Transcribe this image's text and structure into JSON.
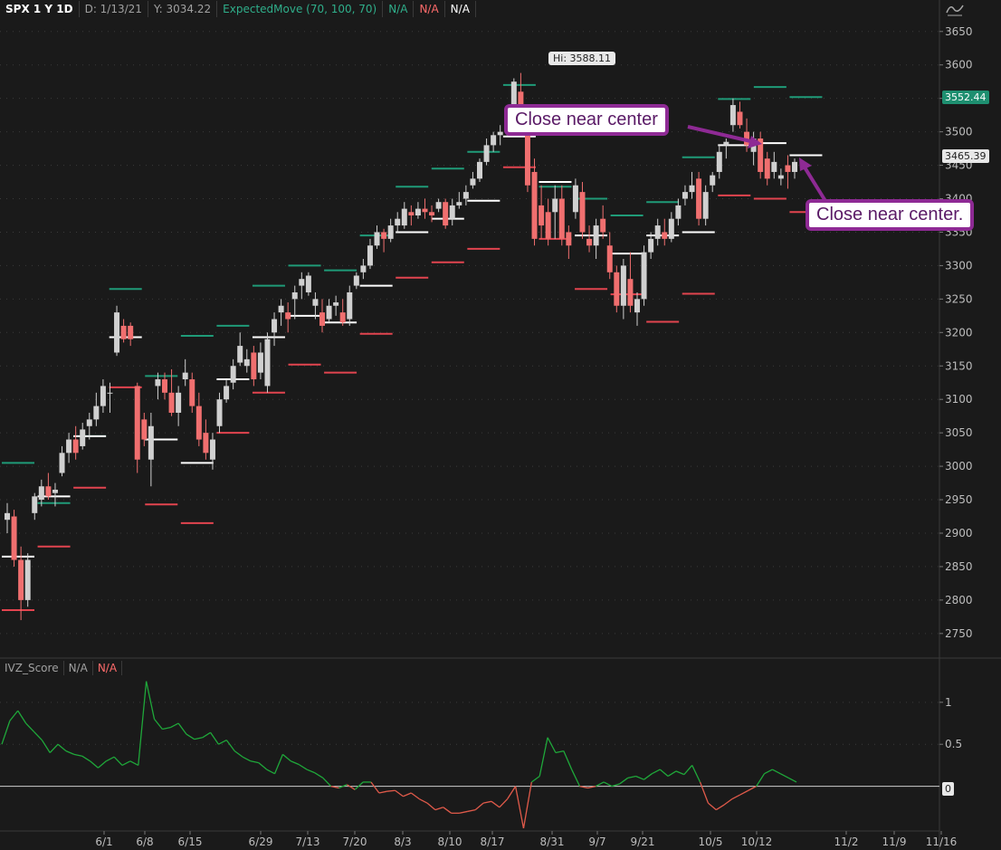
{
  "header": {
    "symbol": "SPX 1 Y 1D",
    "date": "D: 1/13/21",
    "y_readout": "Y: 3034.22",
    "study": "ExpectedMove (70, 100, 70)",
    "v1": "N/A",
    "v2": "N/A",
    "v3": "N/A"
  },
  "lower_header": {
    "study": "IVZ_Score",
    "v1": "N/A",
    "v2": "N/A"
  },
  "colors": {
    "background": "#1a1a1a",
    "up_candle": "#d0d0d0",
    "down_candle": "#f06f6f",
    "upper_band": "#1f9b78",
    "lower_band": "#e2444f",
    "center": "#ffffff",
    "osc_up": "#1fa83a",
    "osc_down": "#e05a4a",
    "callout_border": "#8e2a94"
  },
  "annotations": {
    "hi_label": "Hi: 3588.11",
    "callout1": "Close near center",
    "callout2": "Close near center.",
    "price_badge_green": "3552.44",
    "price_badge_white": "3465.39",
    "osc_badge": "0"
  },
  "chart_data": [
    {
      "type": "candlestick",
      "title": "SPX 1 Y 1D",
      "ylim": [
        2720,
        3670
      ],
      "y_ticks": [
        2750,
        2800,
        2850,
        2900,
        2950,
        3000,
        3050,
        3100,
        3150,
        3200,
        3250,
        3300,
        3350,
        3400,
        3450,
        3500,
        3550,
        3600,
        3650
      ],
      "x_labels": [
        "6/1",
        "6/8",
        "6/15",
        "6/29",
        "7/13",
        "7/20",
        "8/3",
        "8/10",
        "8/17",
        "8/31",
        "9/7",
        "9/21",
        "10/5",
        "10/12",
        "11/2",
        "11/9",
        "11/16"
      ],
      "ohlc": [
        [
          2920,
          2945,
          2900,
          2930
        ],
        [
          2925,
          2935,
          2850,
          2860
        ],
        [
          2860,
          2880,
          2770,
          2800
        ],
        [
          2800,
          2870,
          2790,
          2860
        ],
        [
          2930,
          2960,
          2920,
          2955
        ],
        [
          2950,
          2980,
          2940,
          2970
        ],
        [
          2970,
          2990,
          2950,
          2955
        ],
        [
          2960,
          2975,
          2940,
          2965
        ],
        [
          2990,
          3030,
          2985,
          3020
        ],
        [
          3020,
          3050,
          3005,
          3040
        ],
        [
          3040,
          3060,
          3010,
          3020
        ],
        [
          3030,
          3065,
          3025,
          3055
        ],
        [
          3060,
          3080,
          3040,
          3070
        ],
        [
          3070,
          3110,
          3060,
          3090
        ],
        [
          3090,
          3130,
          3080,
          3120
        ],
        [
          3110,
          3125,
          3080,
          3110
        ],
        [
          3170,
          3240,
          3165,
          3230
        ],
        [
          3210,
          3220,
          3185,
          3190
        ],
        [
          3210,
          3215,
          3180,
          3190
        ],
        [
          3120,
          3125,
          2990,
          3010
        ],
        [
          3070,
          3080,
          3030,
          3040
        ],
        [
          3010,
          3080,
          2970,
          3060
        ],
        [
          3120,
          3140,
          3100,
          3130
        ],
        [
          3130,
          3140,
          3100,
          3110
        ],
        [
          3110,
          3145,
          3075,
          3080
        ],
        [
          3080,
          3120,
          3060,
          3110
        ],
        [
          3130,
          3160,
          3120,
          3140
        ],
        [
          3130,
          3140,
          3080,
          3090
        ],
        [
          3090,
          3110,
          3030,
          3040
        ],
        [
          3050,
          3070,
          3010,
          3020
        ],
        [
          3010,
          3050,
          2995,
          3040
        ],
        [
          3060,
          3110,
          3050,
          3100
        ],
        [
          3100,
          3130,
          3095,
          3120
        ],
        [
          3125,
          3160,
          3115,
          3150
        ],
        [
          3155,
          3200,
          3150,
          3180
        ],
        [
          3150,
          3175,
          3140,
          3160
        ],
        [
          3170,
          3180,
          3120,
          3130
        ],
        [
          3140,
          3185,
          3130,
          3170
        ],
        [
          3120,
          3200,
          3110,
          3190
        ],
        [
          3200,
          3230,
          3180,
          3220
        ],
        [
          3230,
          3250,
          3210,
          3240
        ],
        [
          3230,
          3245,
          3200,
          3220
        ],
        [
          3250,
          3270,
          3220,
          3260
        ],
        [
          3270,
          3290,
          3250,
          3280
        ],
        [
          3260,
          3290,
          3255,
          3285
        ],
        [
          3240,
          3260,
          3220,
          3250
        ],
        [
          3230,
          3250,
          3200,
          3210
        ],
        [
          3220,
          3250,
          3215,
          3240
        ],
        [
          3240,
          3255,
          3225,
          3245
        ],
        [
          3230,
          3250,
          3210,
          3215
        ],
        [
          3220,
          3270,
          3210,
          3260
        ],
        [
          3270,
          3290,
          3265,
          3285
        ],
        [
          3290,
          3310,
          3280,
          3300
        ],
        [
          3300,
          3340,
          3295,
          3330
        ],
        [
          3330,
          3360,
          3325,
          3350
        ],
        [
          3350,
          3355,
          3320,
          3340
        ],
        [
          3340,
          3370,
          3335,
          3360
        ],
        [
          3360,
          3380,
          3350,
          3370
        ],
        [
          3360,
          3395,
          3355,
          3385
        ],
        [
          3380,
          3390,
          3360,
          3375
        ],
        [
          3375,
          3395,
          3370,
          3385
        ],
        [
          3385,
          3400,
          3370,
          3380
        ],
        [
          3380,
          3390,
          3365,
          3375
        ],
        [
          3385,
          3400,
          3380,
          3395
        ],
        [
          3395,
          3400,
          3355,
          3360
        ],
        [
          3370,
          3400,
          3360,
          3390
        ],
        [
          3390,
          3410,
          3385,
          3395
        ],
        [
          3400,
          3420,
          3390,
          3410
        ],
        [
          3420,
          3440,
          3415,
          3430
        ],
        [
          3430,
          3460,
          3425,
          3455
        ],
        [
          3455,
          3490,
          3450,
          3480
        ],
        [
          3480,
          3500,
          3470,
          3495
        ],
        [
          3495,
          3510,
          3480,
          3500
        ],
        [
          3500,
          3530,
          3495,
          3520
        ],
        [
          3520,
          3580,
          3515,
          3575
        ],
        [
          3560,
          3588,
          3520,
          3530
        ],
        [
          3500,
          3505,
          3410,
          3420
        ],
        [
          3440,
          3460,
          3330,
          3340
        ],
        [
          3390,
          3420,
          3340,
          3360
        ],
        [
          3380,
          3400,
          3330,
          3340
        ],
        [
          3380,
          3420,
          3340,
          3400
        ],
        [
          3400,
          3420,
          3330,
          3340
        ],
        [
          3350,
          3360,
          3310,
          3330
        ],
        [
          3380,
          3430,
          3370,
          3420
        ],
        [
          3410,
          3425,
          3340,
          3350
        ],
        [
          3340,
          3360,
          3320,
          3330
        ],
        [
          3330,
          3370,
          3310,
          3360
        ],
        [
          3370,
          3390,
          3340,
          3350
        ],
        [
          3330,
          3350,
          3280,
          3290
        ],
        [
          3290,
          3300,
          3230,
          3240
        ],
        [
          3240,
          3310,
          3220,
          3300
        ],
        [
          3280,
          3320,
          3230,
          3240
        ],
        [
          3230,
          3260,
          3210,
          3250
        ],
        [
          3250,
          3330,
          3240,
          3320
        ],
        [
          3320,
          3350,
          3310,
          3340
        ],
        [
          3340,
          3370,
          3330,
          3360
        ],
        [
          3350,
          3370,
          3330,
          3340
        ],
        [
          3340,
          3380,
          3335,
          3370
        ],
        [
          3370,
          3400,
          3360,
          3390
        ],
        [
          3400,
          3420,
          3390,
          3410
        ],
        [
          3410,
          3440,
          3400,
          3420
        ],
        [
          3430,
          3440,
          3360,
          3370
        ],
        [
          3370,
          3420,
          3360,
          3410
        ],
        [
          3420,
          3440,
          3410,
          3435
        ],
        [
          3440,
          3480,
          3430,
          3470
        ],
        [
          3480,
          3490,
          3460,
          3485
        ],
        [
          3510,
          3550,
          3500,
          3540
        ],
        [
          3530,
          3545,
          3505,
          3510
        ],
        [
          3500,
          3520,
          3470,
          3480
        ],
        [
          3470,
          3500,
          3450,
          3490
        ],
        [
          3490,
          3500,
          3430,
          3440
        ],
        [
          3460,
          3470,
          3420,
          3430
        ],
        [
          3440,
          3470,
          3430,
          3455
        ],
        [
          3430,
          3445,
          3420,
          3435
        ],
        [
          3450,
          3465,
          3415,
          3440
        ],
        [
          3440,
          3460,
          3430,
          3455
        ]
      ],
      "expected_move": [
        {
          "upper": 3005,
          "center": 2865,
          "lower": 2785
        },
        {
          "upper": 2945,
          "center": 2955,
          "lower": 2880
        },
        {
          "upper": 3045,
          "center": 3045,
          "lower": 2968
        },
        {
          "upper": 3265,
          "center": 3193,
          "lower": 3118
        },
        {
          "upper": 3135,
          "center": 3040,
          "lower": 2943
        },
        {
          "upper": 3195,
          "center": 3005,
          "lower": 2915
        },
        {
          "upper": 3210,
          "center": 3130,
          "lower": 3050
        },
        {
          "upper": 3270,
          "center": 3193,
          "lower": 3110
        },
        {
          "upper": 3300,
          "center": 3225,
          "lower": 3152
        },
        {
          "upper": 3293,
          "center": 3215,
          "lower": 3140
        },
        {
          "upper": 3345,
          "center": 3270,
          "lower": 3198
        },
        {
          "upper": 3418,
          "center": 3350,
          "lower": 3282
        },
        {
          "upper": 3445,
          "center": 3370,
          "lower": 3305
        },
        {
          "upper": 3470,
          "center": 3397,
          "lower": 3325
        },
        {
          "upper": 3570,
          "center": 3493,
          "lower": 3447
        },
        {
          "upper": 3418,
          "center": 3425,
          "lower": 3340
        },
        {
          "upper": 3400,
          "center": 3345,
          "lower": 3265
        },
        {
          "upper": 3375,
          "center": 3318,
          "lower": 3257
        },
        {
          "upper": 3395,
          "center": 3345,
          "lower": 3216
        },
        {
          "upper": 3462,
          "center": 3350,
          "lower": 3258
        },
        {
          "upper": 3549,
          "center": 3480,
          "lower": 3405
        },
        {
          "upper": 3567,
          "center": 3483,
          "lower": 3400
        },
        {
          "upper": 3552,
          "center": 3465,
          "lower": 3380
        }
      ]
    },
    {
      "type": "line",
      "title": "IVZ_Score",
      "ylim": [
        -0.5,
        1.3
      ],
      "y_ticks": [
        0.5,
        1
      ],
      "zero_line": 0,
      "values": [
        0.5,
        0.78,
        0.9,
        0.75,
        0.65,
        0.55,
        0.4,
        0.5,
        0.42,
        0.38,
        0.36,
        0.3,
        0.22,
        0.3,
        0.35,
        0.25,
        0.3,
        0.25,
        1.25,
        0.8,
        0.68,
        0.7,
        0.75,
        0.62,
        0.56,
        0.58,
        0.64,
        0.5,
        0.55,
        0.42,
        0.35,
        0.3,
        0.28,
        0.2,
        0.15,
        0.38,
        0.3,
        0.26,
        0.2,
        0.16,
        0.1,
        0.0,
        -0.02,
        0.02,
        -0.04,
        0.05,
        0.05,
        -0.08,
        -0.06,
        -0.05,
        -0.12,
        -0.08,
        -0.15,
        -0.2,
        -0.28,
        -0.25,
        -0.32,
        -0.32,
        -0.3,
        -0.28,
        -0.2,
        -0.18,
        -0.25,
        -0.15,
        0.0,
        -0.5,
        0.05,
        0.12,
        0.58,
        0.4,
        0.42,
        0.2,
        0.0,
        -0.02,
        0.0,
        0.05,
        0.0,
        0.03,
        0.1,
        0.12,
        0.08,
        0.15,
        0.2,
        0.12,
        0.18,
        0.14,
        0.25,
        0.05,
        -0.2,
        -0.28,
        -0.22,
        -0.15,
        -0.1,
        -0.05,
        0.0,
        0.15,
        0.2,
        0.15,
        0.1,
        0.05
      ]
    }
  ]
}
